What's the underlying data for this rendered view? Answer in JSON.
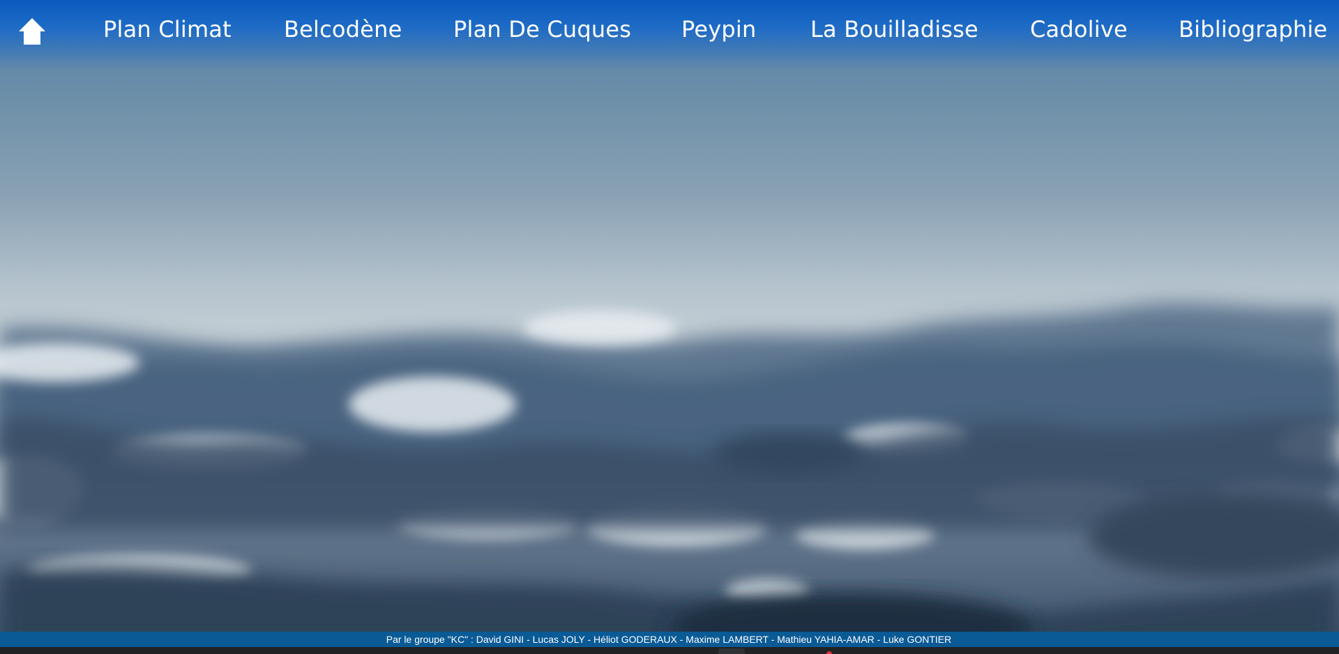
{
  "nav": {
    "home_icon": "home-icon",
    "items": [
      {
        "label": "Plan Climat"
      },
      {
        "label": "Belcodène"
      },
      {
        "label": "Plan De Cuques"
      },
      {
        "label": "Peypin"
      },
      {
        "label": "La Bouilladisse"
      },
      {
        "label": "Cadolive"
      },
      {
        "label": "Bibliographie"
      }
    ]
  },
  "footer": {
    "credits": "Par le groupe \"KC\" : David GINI - Lucas JOLY - Héliot GODERAUX - Maxime LAMBERT - Mathieu YAHIA-AMAR - Luke GONTIER"
  },
  "colors": {
    "nav_top": "#0a5abe",
    "footer_band": "#0a5a96",
    "text": "#ffffff",
    "sky_high": "#7e98ae",
    "sky_horizon": "#c2ccd4",
    "mountains": "#3e5570"
  }
}
